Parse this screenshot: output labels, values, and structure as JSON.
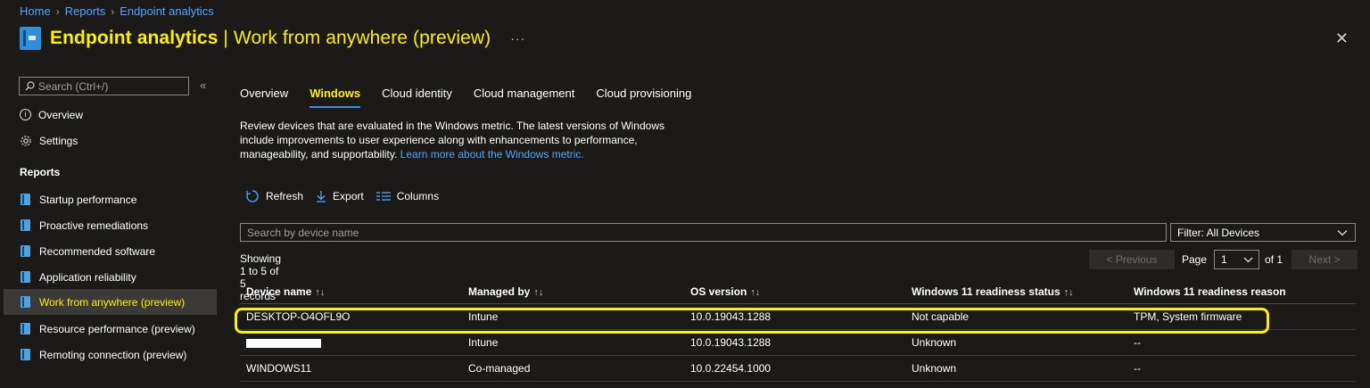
{
  "breadcrumb": [
    "Home",
    "Reports",
    "Endpoint analytics"
  ],
  "header": {
    "title_bold": "Endpoint analytics",
    "title_rest": " | Work from anywhere (preview)",
    "more": "···",
    "close": "✕"
  },
  "sidebar": {
    "search_placeholder": "Search (Ctrl+/)",
    "collapse": "«",
    "top_items": [
      {
        "label": "Overview",
        "icon": "info-icon"
      },
      {
        "label": "Settings",
        "icon": "gear-icon"
      }
    ],
    "section_label": "Reports",
    "report_items": [
      {
        "label": "Startup performance",
        "icon": "report-icon"
      },
      {
        "label": "Proactive remediations",
        "icon": "report-icon"
      },
      {
        "label": "Recommended software",
        "icon": "report-icon"
      },
      {
        "label": "Application reliability",
        "icon": "report-icon"
      },
      {
        "label": "Work from anywhere (preview)",
        "icon": "report-icon",
        "selected": true
      },
      {
        "label": "Resource performance (preview)",
        "icon": "report-icon"
      },
      {
        "label": "Remoting connection (preview)",
        "icon": "report-icon"
      }
    ]
  },
  "tabs": [
    "Overview",
    "Windows",
    "Cloud identity",
    "Cloud management",
    "Cloud provisioning"
  ],
  "active_tab": "Windows",
  "description": {
    "text": "Review devices that are evaluated in the Windows metric. The latest versions of Windows include improvements to user experience along with enhancements to performance, manageability, and supportability. ",
    "link": "Learn more about the Windows metric."
  },
  "toolbar": {
    "refresh": "Refresh",
    "export": "Export",
    "columns": "Columns"
  },
  "device_search_placeholder": "Search by device name",
  "filter": {
    "label": "Filter: All Devices"
  },
  "records": "Showing 1 to 5 of 5 records",
  "pager": {
    "previous": "< Previous",
    "page_label": "Page",
    "page_value": "1",
    "of_label": "of 1",
    "next": "Next >"
  },
  "table": {
    "columns": [
      "Device name",
      "Managed by",
      "OS version",
      "Windows 11 readiness status",
      "Windows 11 readiness reason"
    ],
    "sortable": [
      true,
      true,
      true,
      true,
      false
    ],
    "rows": [
      [
        "DESKTOP-O4OFL9O",
        "Intune",
        "10.0.19043.1288",
        "Not capable",
        "TPM, System firmware"
      ],
      [
        "",
        "Intune",
        "10.0.19043.1288",
        "Unknown",
        "--"
      ],
      [
        "WINDOWS11",
        "Co-managed",
        "10.0.22454.1000",
        "Unknown",
        "--"
      ]
    ]
  },
  "colors": {
    "accent_yellow": "#ffef00",
    "link_blue": "#4ea6ff",
    "background": "#1b1a19"
  }
}
